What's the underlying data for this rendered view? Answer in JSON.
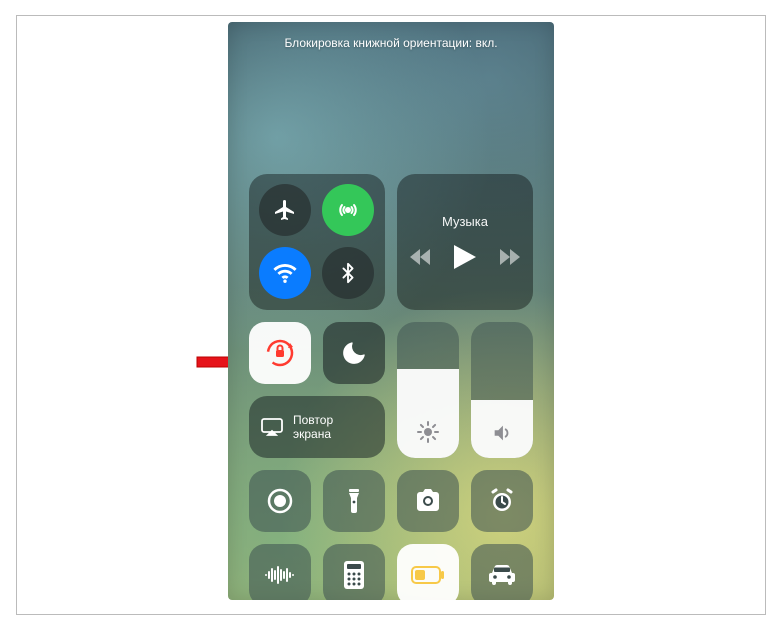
{
  "status_text": "Блокировка книжной ориентации: вкл.",
  "music": {
    "label": "Музыка"
  },
  "mirror": {
    "label": "Повтор экрана"
  },
  "brightness_pct": 65,
  "volume_pct": 42,
  "colors": {
    "green": "#34c759",
    "blue": "#0a7cff",
    "lock_accent": "#ff3b30"
  }
}
